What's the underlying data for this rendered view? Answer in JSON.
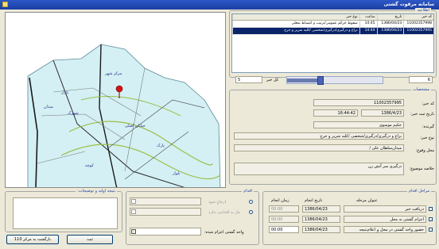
{
  "window": {
    "title": "سامانه مرقوت گشتی"
  },
  "list": {
    "section_label": "اطلاعیه",
    "headers": [
      "کد خبر",
      "تاریخ",
      "ساعت",
      "نوع خبر"
    ],
    "rows": [
      [
        "11002357998",
        "1386/04/23",
        "14:45",
        "سقوط جرائم عمومی/ترتیب و انضباط شغلی"
      ],
      [
        "11002357995",
        "1386/04/23",
        "14:44",
        "نزاع و درگیری/درگیری/شخصی /کلیه شریر و جرح"
      ]
    ]
  },
  "nav": {
    "item_count": "6",
    "total_label": "کل خبر",
    "total_value": "5",
    "progress": 0.35
  },
  "detail": {
    "section_label": "مشخصات",
    "news_code_label": "کد خبر:",
    "news_code": "11002357995",
    "date_label": "تاریخ ثبت خبر:",
    "date": "1386/4/23",
    "time": "16:44:42",
    "recipient_label": "گیرنده:",
    "recipient": "حکیم موسوی",
    "type_label": "نوع خبر:",
    "type": "نزاع و درگیری/درگیری/شخصی /کلیه شریر و جرح",
    "location_label": "محل وقوع:",
    "location": "میدان‌سلطان‌ علی /",
    "subject_label": "خلاصه موضوع:",
    "subject": "درگیری سر آتش زن"
  },
  "stages": {
    "title": "مراحل اقدام",
    "headers": [
      "عنوان مرحله",
      "تاریخ انجام",
      "زمان انجام"
    ],
    "rows": [
      {
        "name": "دریافت خبر",
        "date": "1386/04/23",
        "time": "00:00"
      },
      {
        "name": "اعزام گشتی به محل",
        "date": "1386/04/23",
        "time": "00:00"
      },
      {
        "name": "حضور واحد گشتی در محل و اعلام‌نتیجه",
        "date": "1386/04/23",
        "time": "00:00"
      }
    ]
  },
  "action": {
    "title": "اقدام",
    "option1": "ارجاع شود",
    "option2": "نیاز به اقدامی ندارد",
    "unit_label": "واحد گشتی اعزام شده:"
  },
  "report": {
    "title": "نتیجه اولیه و توضیحات:"
  },
  "buttons": {
    "register": "ثبت",
    "back": "بازگشت به مرکز 110"
  },
  "map_labels": [
    "مرکز شهر",
    "بازار",
    "میدان",
    "شهرک",
    "خیابان اصلی",
    "پارک",
    "کوچه",
    "بلوار"
  ]
}
